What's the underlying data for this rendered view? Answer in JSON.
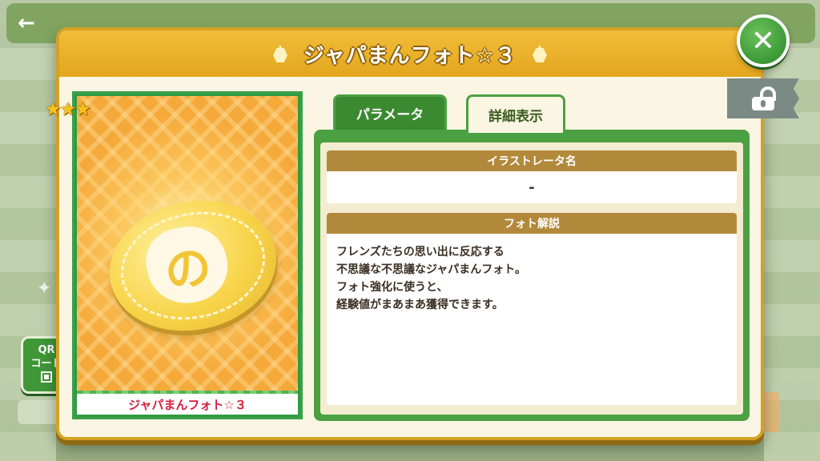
{
  "dialog": {
    "title": "ジャパまんフォト☆３"
  },
  "card": {
    "stars": "★★★",
    "name": "ジャパまんフォト☆３",
    "emblem": "の"
  },
  "tabs": [
    {
      "label": "パラメータ",
      "active": false
    },
    {
      "label": "詳細表示",
      "active": true
    }
  ],
  "details": {
    "illustrator_heading": "イラストレータ名",
    "illustrator_value": "-",
    "description_heading": "フォト解説",
    "description_lines": [
      "フレンズたちの思い出に反応する",
      "不思議な不思議なジャパまんフォト。",
      "フォト強化に使うと、",
      "経験値がまあまあ獲得できます。"
    ]
  },
  "qr_button": {
    "line1": "QR",
    "line2": "コード"
  },
  "close_button": {
    "label": "✕"
  },
  "colors": {
    "header_gold": "#e3a61e",
    "frame_green": "#4ba042",
    "card_name_red": "#d3213b"
  }
}
